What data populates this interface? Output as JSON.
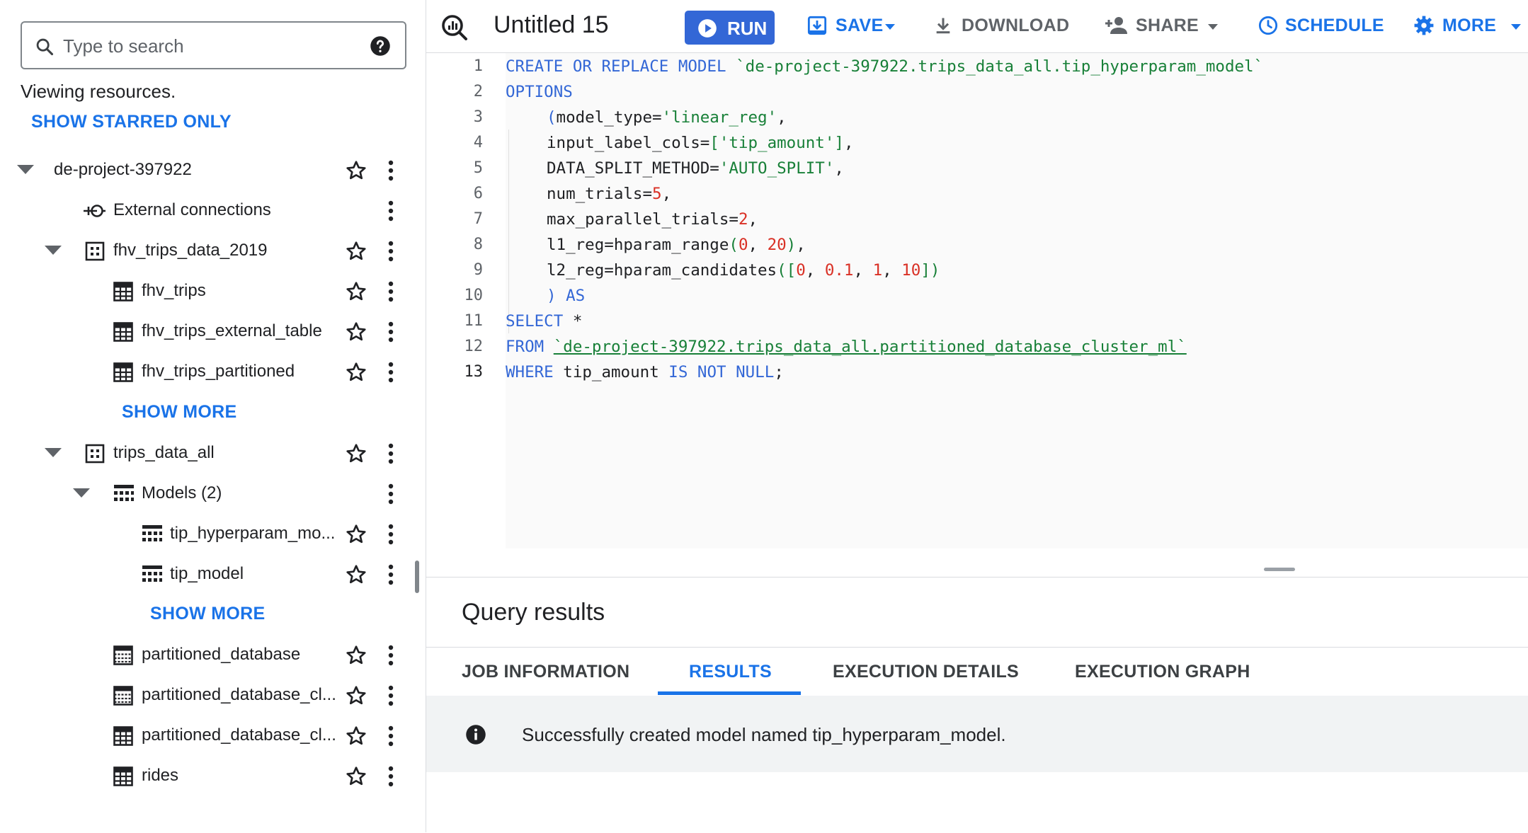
{
  "search": {
    "placeholder": "Type to search"
  },
  "explorer": {
    "viewing_text": "Viewing resources.",
    "show_starred_label": "SHOW STARRED ONLY",
    "items": [
      {
        "label": "de-project-397922",
        "icon": "project"
      },
      {
        "label": "External connections",
        "icon": "external-connection-icon"
      },
      {
        "label": "fhv_trips_data_2019",
        "icon": "dataset-icon"
      },
      {
        "label": "fhv_trips",
        "icon": "table-icon"
      },
      {
        "label": "fhv_trips_external_table",
        "icon": "table-icon"
      },
      {
        "label": "fhv_trips_partitioned",
        "icon": "table-icon"
      },
      {
        "label": "SHOW MORE"
      },
      {
        "label": "trips_data_all",
        "icon": "dataset-icon"
      },
      {
        "label": "Models (2)",
        "icon": "model-icon"
      },
      {
        "label": "tip_hyperparam_mo...",
        "icon": "model-icon"
      },
      {
        "label": "tip_model",
        "icon": "model-icon"
      },
      {
        "label": "SHOW MORE"
      },
      {
        "label": "partitioned_database",
        "icon": "partitioned-table-icon"
      },
      {
        "label": "partitioned_database_cl...",
        "icon": "partitioned-table-icon"
      },
      {
        "label": "partitioned_database_cl...",
        "icon": "table-icon"
      },
      {
        "label": "rides",
        "icon": "table-icon"
      }
    ]
  },
  "toolbar": {
    "title": "Untitled 15",
    "run_label": "RUN",
    "save_label": "SAVE",
    "download_label": "DOWNLOAD",
    "share_label": "SHARE",
    "schedule_label": "SCHEDULE",
    "more_label": "MORE"
  },
  "editor": {
    "line_numbers": [
      "1",
      "2",
      "3",
      "4",
      "5",
      "6",
      "7",
      "8",
      "9",
      "10",
      "11",
      "12",
      "13"
    ],
    "lines": {
      "l1": {
        "kw": "CREATE OR REPLACE MODEL",
        "str": "`de-project-397922.trips_data_all.tip_hyperparam_model`"
      },
      "l2": {
        "kw": "OPTIONS"
      },
      "l3": {
        "p": "(",
        "a": "model_type=",
        "s": "'linear_reg'",
        "c": ","
      },
      "l4": {
        "a": "input_label_cols=",
        "p1": "[",
        "s": "'tip_amount'",
        "p2": "]",
        "c": ","
      },
      "l5": {
        "a": "DATA_SPLIT_METHOD=",
        "s": "'AUTO_SPLIT'",
        "c": ","
      },
      "l6": {
        "a": "num_trials=",
        "n": "5",
        "c": ","
      },
      "l7": {
        "a": "max_parallel_trials=",
        "n": "2",
        "c": ","
      },
      "l8": {
        "a": "l1_reg=hparam_range",
        "p1": "(",
        "n1": "0",
        "c1": ", ",
        "n2": "20",
        "p2": ")",
        "c": ","
      },
      "l9": {
        "a": "l2_reg=hparam_candidates",
        "p1": "([",
        "n1": "0",
        "c1": ", ",
        "n2": "0.1",
        "c2": ", ",
        "n3": "1",
        "c3": ", ",
        "n4": "10",
        "p2": "])"
      },
      "l10": {
        "p": ")",
        "kw": " AS"
      },
      "l11": {
        "kw": "SELECT",
        "t": " *"
      },
      "l12": {
        "kw": "FROM",
        "str": "`de-project-397922.trips_data_all.partitioned_database_cluster_ml`"
      },
      "l13": {
        "kw1": "WHERE",
        "t": " tip_amount ",
        "kw2": "IS NOT NULL",
        "e": ";"
      }
    }
  },
  "results": {
    "title": "Query results",
    "tabs": [
      "JOB INFORMATION",
      "RESULTS",
      "EXECUTION DETAILS",
      "EXECUTION GRAPH"
    ],
    "active_tab": "RESULTS",
    "message": "Successfully created model named tip_hyperparam_model."
  },
  "colors": {
    "accent": "#1a73e8",
    "run_button": "#3367d6",
    "keyword": "#3367d6",
    "string": "#188038",
    "number": "#d93025"
  }
}
